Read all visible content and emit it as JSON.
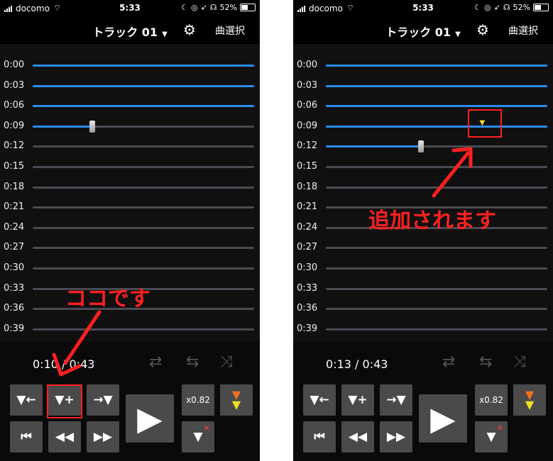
{
  "status": {
    "carrier": "docomo",
    "time": "5:33",
    "battery": "52%",
    "battery_fraction": 0.52
  },
  "header": {
    "track_title": "トラック 01",
    "song_select": "曲選択"
  },
  "timeline_labels": [
    "0:00",
    "0:03",
    "0:06",
    "0:09",
    "0:12",
    "0:15",
    "0:18",
    "0:21",
    "0:24",
    "0:27",
    "0:30",
    "0:33",
    "0:36",
    "0:39"
  ],
  "left": {
    "time_readout": "0:10 / 0:43",
    "playhead_row": 3,
    "playhead_fraction": 0.27,
    "annotation": "ココです"
  },
  "right": {
    "time_readout": "0:13 / 0:43",
    "playhead_row": 4,
    "playhead_fraction": 0.43,
    "marker_row": 3,
    "marker_fraction": 0.71,
    "annotation": "追加されます"
  },
  "controls": {
    "mark_back": "▼←",
    "mark_add": "▼+",
    "mark_forward": "→▼",
    "speed": "x0.82",
    "skip_start": "⏮",
    "rewind": "◀◀",
    "fast_forward": "▶▶",
    "play": "▶",
    "delete_mark": "▼",
    "delete_x": "✕"
  },
  "colors": {
    "accent_blue": "#2a8cf0",
    "annotation_red": "#ff2020",
    "marker_yellow": "#f0e020"
  }
}
